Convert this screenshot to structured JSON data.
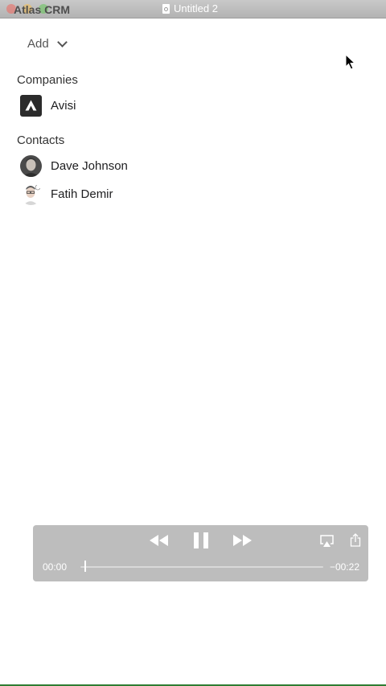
{
  "window": {
    "app_name": "Atlas CRM",
    "document_title": "Untitled 2"
  },
  "toolbar": {
    "add_label": "Add"
  },
  "companies": {
    "header": "Companies",
    "items": [
      {
        "name": "Avisi",
        "icon": "avisi-logo-icon"
      }
    ]
  },
  "contacts": {
    "header": "Contacts",
    "items": [
      {
        "name": "Dave Johnson",
        "icon": "avatar"
      },
      {
        "name": "Fatih Demir",
        "icon": "avatar"
      }
    ]
  },
  "player": {
    "elapsed": "00:00",
    "remaining": "−00:22",
    "progress": 0.0
  },
  "colors": {
    "titlebar": "#b3b3b3",
    "player_bg": "#bdbdbd",
    "logo_bg": "#2b2b2b",
    "bottom_accent": "#2f7d32"
  }
}
